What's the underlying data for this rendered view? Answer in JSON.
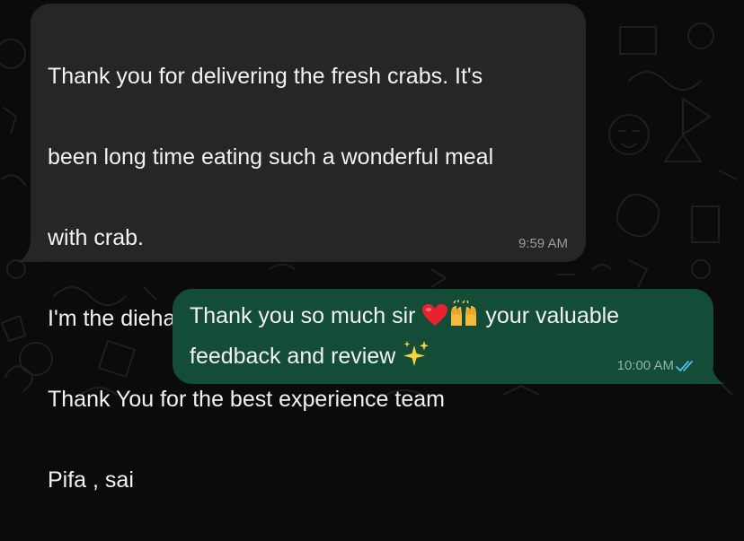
{
  "colors": {
    "background": "#0b0b0b",
    "incoming_bubble": "#252626",
    "outgoing_bubble": "#144d37",
    "text": "#f2f2f2",
    "timestamp": "#9a9b9b",
    "read_ticks": "#53bdeb"
  },
  "messages": {
    "incoming": {
      "lines": [
        "Thank you for delivering the fresh crabs. It's",
        "been long time eating such a wonderful meal",
        "with crab.",
        "I'm the diehard fan of those.",
        "Thank You for the best experience team",
        "Pifa , sai"
      ],
      "time": "9:59 AM"
    },
    "outgoing": {
      "line1_prefix": "Thank you so much sir ",
      "heart_emoji": "❤️",
      "hands_emoji": "🙌",
      "line1_suffix": " your valuable",
      "line2_prefix": "feedback and review ",
      "sparkles_emoji": "✨",
      "time": "10:00 AM",
      "status_icon": "double-check-read-icon"
    }
  }
}
